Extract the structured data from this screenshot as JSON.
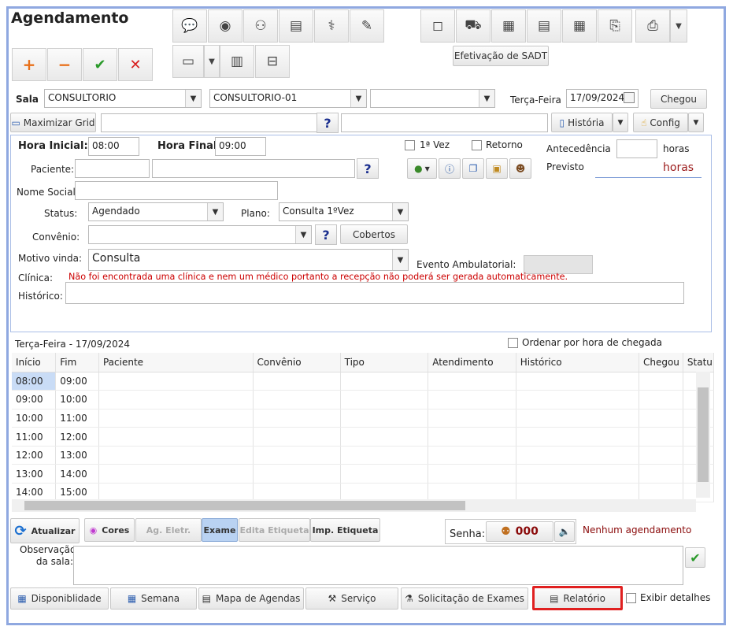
{
  "title": "Agendamento",
  "buttons": {
    "efetivacao": "Efetivação de SADT",
    "chegou": "Chegou",
    "maximizar": "Maximizar Grid",
    "historia": "História",
    "config": "Config",
    "cobertos": "Cobertos"
  },
  "sala": {
    "label": "Sala",
    "value1": "CONSULTORIO",
    "value2": "CONSULTORIO-01",
    "value3": "",
    "day_label": "Terça-Feira",
    "date": "17/09/2024"
  },
  "form": {
    "hora_inicial_label": "Hora Inicial:",
    "hora_inicial": "08:00",
    "hora_final_label": "Hora Final:",
    "hora_final": "09:00",
    "primeira_vez": "1ª Vez",
    "retorno": "Retorno",
    "antecedencia_label": "Antecedência",
    "horas_label": "horas",
    "previsto_label": "Previsto",
    "previsto_value": "horas",
    "paciente_label": "Paciente:",
    "nome_social_label": "Nome Social:",
    "status_label": "Status:",
    "status_value": "Agendado",
    "plano_label": "Plano:",
    "plano_value": "Consulta 1ºVez",
    "convenio_label": "Convênio:",
    "motivo_label": "Motivo vinda:",
    "motivo_value": "Consulta",
    "evento_label": "Evento Ambulatorial:",
    "clinica_label": "Clínica:",
    "clinica_warning": "Não foi encontrada uma clínica e nem um médico portanto a recepção não poderá ser gerada automaticamente.",
    "historico_label": "Histórico:"
  },
  "grid": {
    "date_caption": "Terça-Feira - 17/09/2024",
    "order_label": "Ordenar por hora de chegada",
    "columns": [
      "Início",
      "Fim",
      "Paciente",
      "Convênio",
      "Tipo",
      "Atendimento",
      "Histórico",
      "Chegou",
      "Statu"
    ],
    "rows": [
      {
        "inicio": "08:00",
        "fim": "09:00"
      },
      {
        "inicio": "09:00",
        "fim": "10:00"
      },
      {
        "inicio": "10:00",
        "fim": "11:00"
      },
      {
        "inicio": "11:00",
        "fim": "12:00"
      },
      {
        "inicio": "12:00",
        "fim": "13:00"
      },
      {
        "inicio": "13:00",
        "fim": "14:00"
      },
      {
        "inicio": "14:00",
        "fim": "15:00"
      }
    ]
  },
  "actions": {
    "atualizar": "Atualizar",
    "cores": "Cores",
    "ag_eletr": "Ag. Eletr.",
    "exame": "Exame",
    "edita_etiqueta": "Edita Etiqueta",
    "imp_etiqueta": "Imp. Etiqueta",
    "senha_label": "Senha:",
    "senha_value": "000",
    "nenhum": "Nenhum agendamento",
    "observacao_label": "Observação da sala:"
  },
  "bottom": {
    "disponibilidade": "Disponiblidade",
    "semana": "Semana",
    "mapa": "Mapa de Agendas",
    "servico": "Serviço",
    "solicitacao": "Solicitação de Exames",
    "relatorio": "Relatório",
    "exibir": "Exibir detalhes"
  },
  "colors": {
    "frame": "#8fa8e0",
    "warning": "#cc0000",
    "highlight": "#e02020",
    "plus": "#e8701a",
    "check": "#2a9a2a",
    "cross": "#d82020"
  }
}
